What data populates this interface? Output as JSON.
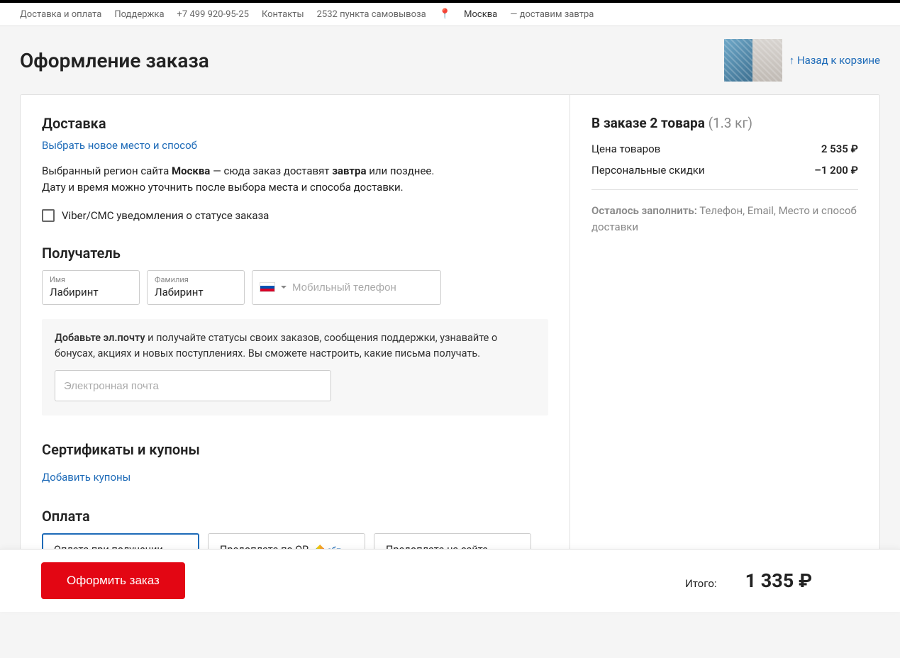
{
  "topbar": {
    "delivery_pay": "Доставка и оплата",
    "support": "Поддержка",
    "phone": "+7 499 920-95-25",
    "contacts": "Контакты",
    "pickup_points": "2532 пункта самовывоза",
    "city": "Москва",
    "delivery_when": "—   доставим завтра"
  },
  "header": {
    "title": "Оформление заказа",
    "back": "↑ Назад к корзине"
  },
  "delivery": {
    "title": "Доставка",
    "choose_link": "Выбрать новое место и способ",
    "region_prefix": "Выбранный регион сайта ",
    "region_city": "Москва",
    "region_mid": " — сюда заказ доставят ",
    "when": "завтра",
    "suffix": " или позднее.",
    "line2": "Дату и время можно уточнить после выбора места и способа доставки.",
    "sms_label": "Viber/СМС уведомления о статусе заказа"
  },
  "recipient": {
    "title": "Получатель",
    "name_label": "Имя",
    "name_value": "Лабиринт",
    "surname_label": "Фамилия",
    "surname_value": "Лабиринт",
    "phone_placeholder": "Мобильный телефон"
  },
  "email": {
    "bold": "Добавьте эл.почту",
    "text": " и получайте статусы своих заказов, сообщения поддержки, узнавайте о бонусах, акциях и новых поступлениях. Вы сможете настроить, какие письма получать.",
    "placeholder": "Электронная почта"
  },
  "coupons": {
    "title": "Сертификаты и купоны",
    "add_link": "Добавить купоны"
  },
  "payment": {
    "title": "Оплата",
    "tabs": [
      "Оплата при получении",
      "Предоплата по QR",
      "Предоплата на сайте"
    ],
    "sbp_label": "сбп"
  },
  "summary": {
    "title_bold": "В заказе 2 товара",
    "weight": " (1.3 кг)",
    "items_label": "Цена товаров",
    "items_value": "2 535 ₽",
    "disc_label": "Персональные скидки",
    "disc_value": "–1 200 ₽",
    "todo_strong": "Осталось заполнить:",
    "todo_rest": "  Телефон, Email, Место и способ доставки"
  },
  "footer": {
    "order_btn": "Оформить заказ",
    "total_label": "Итого:",
    "total_value": "1 335 ₽"
  }
}
